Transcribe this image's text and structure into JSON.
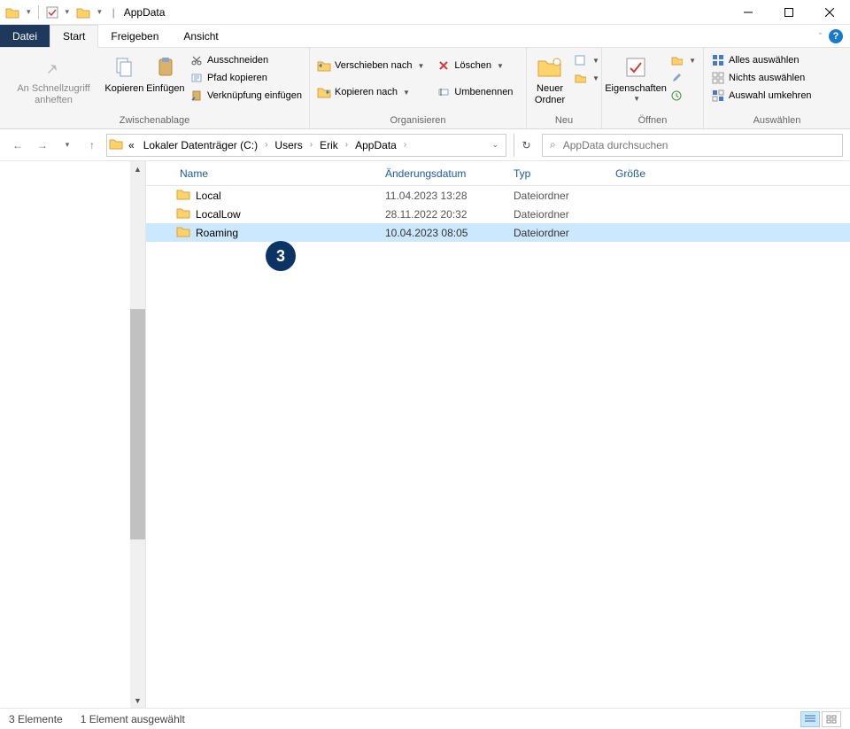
{
  "window": {
    "title": "AppData"
  },
  "tabs": {
    "datei": "Datei",
    "start": "Start",
    "freigeben": "Freigeben",
    "ansicht": "Ansicht"
  },
  "ribbon": {
    "clipboard": {
      "pin": "An Schnellzugriff anheften",
      "copy": "Kopieren",
      "paste": "Einfügen",
      "cut": "Ausschneiden",
      "copypath": "Pfad kopieren",
      "pasteshortcut": "Verknüpfung einfügen",
      "label": "Zwischenablage"
    },
    "organize": {
      "move": "Verschieben nach",
      "copyto": "Kopieren nach",
      "delete": "Löschen",
      "rename": "Umbenennen",
      "label": "Organisieren"
    },
    "new": {
      "newfolder": "Neuer Ordner",
      "label": "Neu"
    },
    "open": {
      "properties": "Eigenschaften",
      "label": "Öffnen"
    },
    "select": {
      "all": "Alles auswählen",
      "none": "Nichts auswählen",
      "invert": "Auswahl umkehren",
      "label": "Auswählen"
    }
  },
  "breadcrumbs": {
    "prefix": "«",
    "items": [
      "Lokaler Datenträger (C:)",
      "Users",
      "Erik",
      "AppData"
    ]
  },
  "search": {
    "placeholder": "AppData durchsuchen"
  },
  "columns": {
    "name": "Name",
    "date": "Änderungsdatum",
    "type": "Typ",
    "size": "Größe"
  },
  "rows": [
    {
      "name": "Local",
      "date": "11.04.2023 13:28",
      "type": "Dateiordner",
      "size": "",
      "selected": false
    },
    {
      "name": "LocalLow",
      "date": "28.11.2022 20:32",
      "type": "Dateiordner",
      "size": "",
      "selected": false
    },
    {
      "name": "Roaming",
      "date": "10.04.2023 08:05",
      "type": "Dateiordner",
      "size": "",
      "selected": true
    }
  ],
  "status": {
    "count": "3 Elemente",
    "selected": "1 Element ausgewählt"
  },
  "annotation": {
    "badge": "3"
  }
}
